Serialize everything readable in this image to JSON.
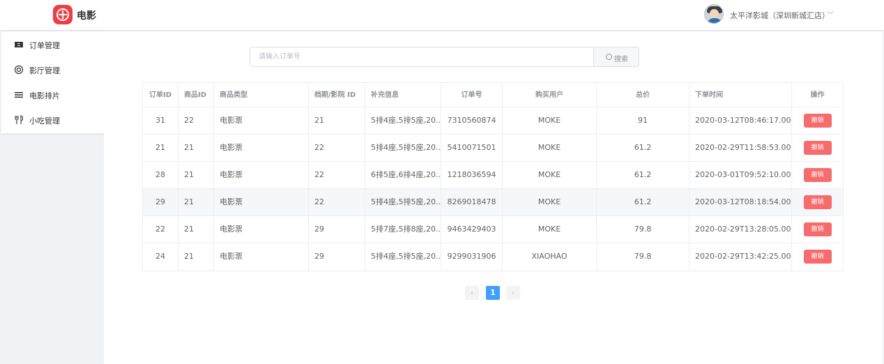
{
  "header": {
    "brand": "电影",
    "user_name": "太平洋影城（深圳新城汇店）",
    "caret": "﹀"
  },
  "sidebar": {
    "items": [
      {
        "label": "订单管理",
        "icon": "ticket-icon"
      },
      {
        "label": "影厅管理",
        "icon": "hall-icon"
      },
      {
        "label": "电影排片",
        "icon": "schedule-list-icon"
      },
      {
        "label": "小吃管理",
        "icon": "utensils-icon"
      }
    ]
  },
  "search": {
    "placeholder": "请输入订单号",
    "button_label": "搜索"
  },
  "table": {
    "headers": [
      "订单ID",
      "商品ID",
      "商品类型",
      "档期/影院 ID",
      "补充信息",
      "订单号",
      "购买用户",
      "总价",
      "下单时间",
      "操作"
    ],
    "rows": [
      [
        "31",
        "22",
        "电影票",
        "21",
        "5排4座,5排5座,20...",
        "7310560874",
        "MOKE",
        "91",
        "2020-03-12T08:46:17.00...",
        "撤销"
      ],
      [
        "21",
        "21",
        "电影票",
        "22",
        "5排4座,5排5座,20...",
        "5410071501",
        "MOKE",
        "61.2",
        "2020-02-29T11:58:53.00...",
        "撤销"
      ],
      [
        "28",
        "21",
        "电影票",
        "22",
        "6排5座,6排4座,20...",
        "1218036594",
        "MOKE",
        "61.2",
        "2020-03-01T09:52:10.00...",
        "撤销"
      ],
      [
        "29",
        "21",
        "电影票",
        "22",
        "5排4座,5排5座,20...",
        "8269018478",
        "MOKE",
        "61.2",
        "2020-03-12T08:18:54.00...",
        "撤销"
      ],
      [
        "22",
        "21",
        "电影票",
        "29",
        "5排7座,5排8座,20...",
        "9463429403",
        "MOKE",
        "79.8",
        "2020-02-29T13:28:05.00...",
        "撤销"
      ],
      [
        "24",
        "21",
        "电影票",
        "29",
        "5排4座,5排5座,20...",
        "9299031906",
        "XIAOHAO",
        "79.8",
        "2020-02-29T13:42:25.00...",
        "撤销"
      ]
    ]
  },
  "pagination": {
    "prev": "‹",
    "current": "1",
    "next": "›"
  },
  "colors": {
    "brand": "#ef3d46",
    "danger": "#f56c6c",
    "primary": "#409eff"
  }
}
